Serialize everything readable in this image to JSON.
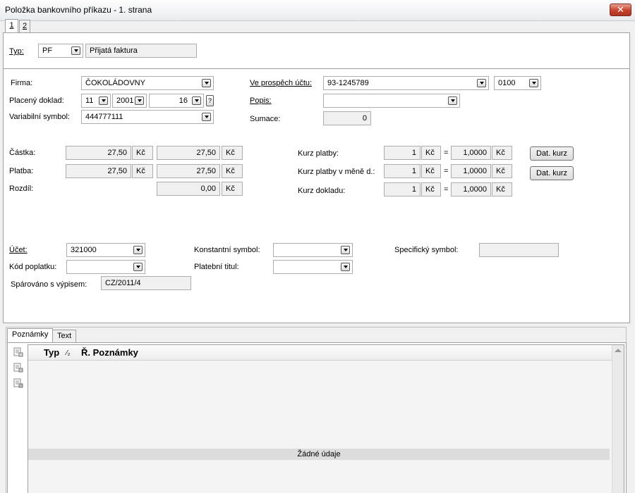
{
  "window": {
    "title": "Položka bankovního příkazu - 1. strana",
    "close_label": "✕"
  },
  "pages": [
    "1",
    "2"
  ],
  "typ": {
    "label": "Typ:",
    "code": "PF",
    "name": "Přijatá faktura"
  },
  "firma": {
    "label": "Firma:",
    "value": "ČOKOLÁDOVNY"
  },
  "placeny_doklad": {
    "label": "Placený doklad:",
    "month": "11",
    "year": "2001",
    "number": "16",
    "help": "?"
  },
  "variabilni_symbol": {
    "label": "Variabilní symbol:",
    "value": "444777111"
  },
  "ve_prospech": {
    "label": "Ve prospěch účtu:",
    "account": "93-1245789",
    "bank": "0100"
  },
  "popis": {
    "label": "Popis:",
    "value": ""
  },
  "sumace": {
    "label": "Sumace:",
    "value": "0"
  },
  "castka": {
    "label": "Částka:",
    "v1": "27,50",
    "c1": "Kč",
    "v2": "27,50",
    "c2": "Kč"
  },
  "platba": {
    "label": "Platba:",
    "v1": "27,50",
    "c1": "Kč",
    "v2": "27,50",
    "c2": "Kč"
  },
  "rozdil": {
    "label": "Rozdíl:",
    "v2": "0,00",
    "c2": "Kč"
  },
  "kurz_platby": {
    "label": "Kurz platby:",
    "q": "1",
    "c1": "Kč",
    "eq": "=",
    "rate": "1,0000",
    "c2": "Kč",
    "button": "Dat. kurz"
  },
  "kurz_meny": {
    "label": "Kurz platby v měně d.:",
    "q": "1",
    "c1": "Kč",
    "eq": "=",
    "rate": "1,0000",
    "c2": "Kč",
    "button": "Dat. kurz"
  },
  "kurz_dokladu": {
    "label": "Kurz dokladu:",
    "q": "1",
    "c1": "Kč",
    "eq": "=",
    "rate": "1,0000",
    "c2": "Kč"
  },
  "ucet": {
    "label": "Účet:",
    "value": "321000"
  },
  "kod_poplatku": {
    "label": "Kód poplatku:",
    "value": ""
  },
  "sparovano": {
    "label": "Spárováno s výpisem:",
    "value": "CZ/2011/4"
  },
  "konstantni_symbol": {
    "label": "Konstantní symbol:",
    "value": ""
  },
  "platebni_titul": {
    "label": "Platební titul:",
    "value": ""
  },
  "specificky_symbol": {
    "label": "Specifický symbol:",
    "value": ""
  },
  "notes": {
    "tabs": [
      "Poznámky",
      "Text"
    ],
    "columns": {
      "typ": "Typ",
      "sort": "⁄₂",
      "poznamky": "Ř. Poznámky"
    },
    "empty": "Žádné údaje"
  }
}
